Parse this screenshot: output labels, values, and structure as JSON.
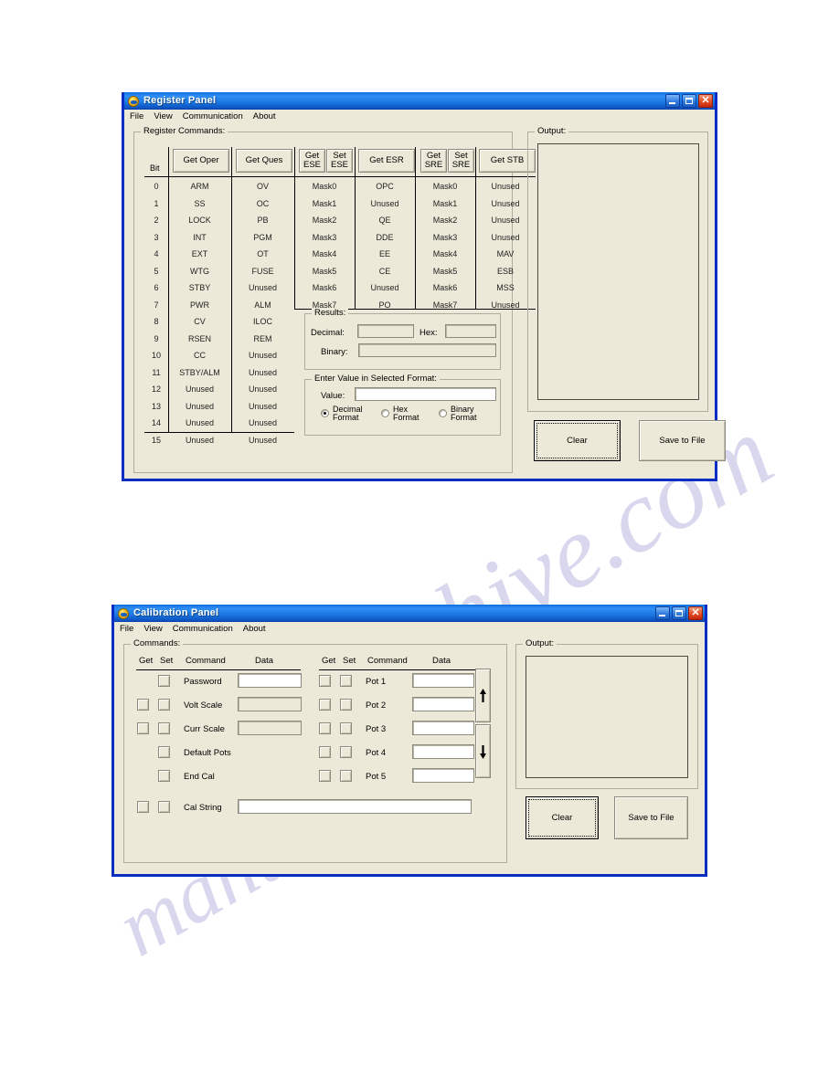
{
  "register_panel": {
    "title": "Register Panel",
    "icon": "globe-icon",
    "window_buttons": {
      "minimize": "_",
      "maximize": "□",
      "close": "✕"
    },
    "menu": [
      "File",
      "View",
      "Communication",
      "About"
    ],
    "commands_group_label": "Register Commands:",
    "bit_header": "Bit",
    "command_buttons": [
      {
        "label": "Get Oper",
        "lines": [
          "Get Oper"
        ]
      },
      {
        "label": "Get Ques",
        "lines": [
          "Get Ques"
        ]
      },
      {
        "label": "Get ESE",
        "lines": [
          "Get",
          "ESE"
        ]
      },
      {
        "label": "Set ESE",
        "lines": [
          "Set",
          "ESE"
        ]
      },
      {
        "label": "Get ESR",
        "lines": [
          "Get ESR"
        ]
      },
      {
        "label": "Get SRE",
        "lines": [
          "Get",
          "SRE"
        ]
      },
      {
        "label": "Set SRE",
        "lines": [
          "Set",
          "SRE"
        ]
      },
      {
        "label": "Get STB",
        "lines": [
          "Get STB"
        ]
      }
    ],
    "bits": [
      "0",
      "1",
      "2",
      "3",
      "4",
      "5",
      "6",
      "7",
      "8",
      "9",
      "10",
      "11",
      "12",
      "13",
      "14",
      "15"
    ],
    "columns": [
      {
        "name": "oper",
        "values": [
          "ARM",
          "SS",
          "LOCK",
          "INT",
          "EXT",
          "WTG",
          "STBY",
          "PWR",
          "CV",
          "RSEN",
          "CC",
          "STBY/ALM",
          "Unused",
          "Unused",
          "Unused",
          "Unused"
        ]
      },
      {
        "name": "ques",
        "values": [
          "OV",
          "OC",
          "PB",
          "PGM",
          "OT",
          "FUSE",
          "Unused",
          "ALM",
          "ILOC",
          "REM",
          "Unused",
          "Unused",
          "Unused",
          "Unused",
          "Unused",
          "Unused"
        ]
      },
      {
        "name": "ese",
        "values": [
          "Mask0",
          "Mask1",
          "Mask2",
          "Mask3",
          "Mask4",
          "Mask5",
          "Mask6",
          "Mask7"
        ]
      },
      {
        "name": "esr",
        "values": [
          "OPC",
          "Unused",
          "QE",
          "DDE",
          "EE",
          "CE",
          "Unused",
          "PO"
        ]
      },
      {
        "name": "sre",
        "values": [
          "Mask0",
          "Mask1",
          "Mask2",
          "Mask3",
          "Mask4",
          "Mask5",
          "Mask6",
          "Mask7"
        ]
      },
      {
        "name": "stb",
        "values": [
          "Unused",
          "Unused",
          "Unused",
          "Unused",
          "MAV",
          "ESB",
          "MSS",
          "Unused"
        ]
      }
    ],
    "results": {
      "group_label": "Results:",
      "decimal_label": "Decimal:",
      "decimal_value": "",
      "hex_label": "Hex:",
      "hex_value": "",
      "binary_label": "Binary:",
      "binary_value": ""
    },
    "enter_value": {
      "group_label": "Enter Value in Selected Format:",
      "value_label": "Value:",
      "value": "",
      "value_placeholder": "",
      "formats": [
        {
          "label_lines": [
            "Decimal",
            "Format"
          ],
          "selected": true
        },
        {
          "label_lines": [
            "Hex",
            "Format"
          ],
          "selected": false
        },
        {
          "label_lines": [
            "Binary",
            "Format"
          ],
          "selected": false
        }
      ]
    },
    "output": {
      "group_label": "Output:",
      "text": "",
      "clear_label": "Clear",
      "save_label": "Save to File"
    }
  },
  "calibration_panel": {
    "title": "Calibration Panel",
    "icon": "globe-icon",
    "window_buttons": {
      "minimize": "_",
      "maximize": "□",
      "close": "✕"
    },
    "menu": [
      "File",
      "View",
      "Communication",
      "About"
    ],
    "commands_group_label": "Commands:",
    "headers": {
      "get": "Get",
      "set": "Set",
      "command": "Command",
      "data": "Data"
    },
    "left_rows": [
      {
        "command": "Password",
        "get": false,
        "set": true,
        "data_field": true,
        "data_value": "",
        "readonly": false
      },
      {
        "command": "Volt Scale",
        "get": true,
        "set": true,
        "data_field": true,
        "data_value": "",
        "readonly": true
      },
      {
        "command": "Curr Scale",
        "get": true,
        "set": true,
        "data_field": true,
        "data_value": "",
        "readonly": true
      },
      {
        "command": "Default Pots",
        "get": false,
        "set": true,
        "data_field": false,
        "data_value": "",
        "readonly": false
      },
      {
        "command": "End Cal",
        "get": false,
        "set": true,
        "data_field": false,
        "data_value": "",
        "readonly": false
      }
    ],
    "right_rows": [
      {
        "command": "Pot 1",
        "get": true,
        "set": true,
        "data_value": ""
      },
      {
        "command": "Pot 2",
        "get": true,
        "set": true,
        "data_value": ""
      },
      {
        "command": "Pot 3",
        "get": true,
        "set": true,
        "data_value": ""
      },
      {
        "command": "Pot 4",
        "get": true,
        "set": true,
        "data_value": ""
      },
      {
        "command": "Pot 5",
        "get": true,
        "set": true,
        "data_value": ""
      }
    ],
    "cal_string_row": {
      "command": "Cal String",
      "get": true,
      "set": true,
      "data_value": ""
    },
    "steppers": {
      "up": "up-arrow",
      "down": "down-arrow"
    },
    "output": {
      "group_label": "Output:",
      "text": "",
      "clear_label": "Clear",
      "save_label": "Save to File"
    }
  },
  "watermark": {
    "line1": "alshive.com",
    "line2": "manual"
  }
}
